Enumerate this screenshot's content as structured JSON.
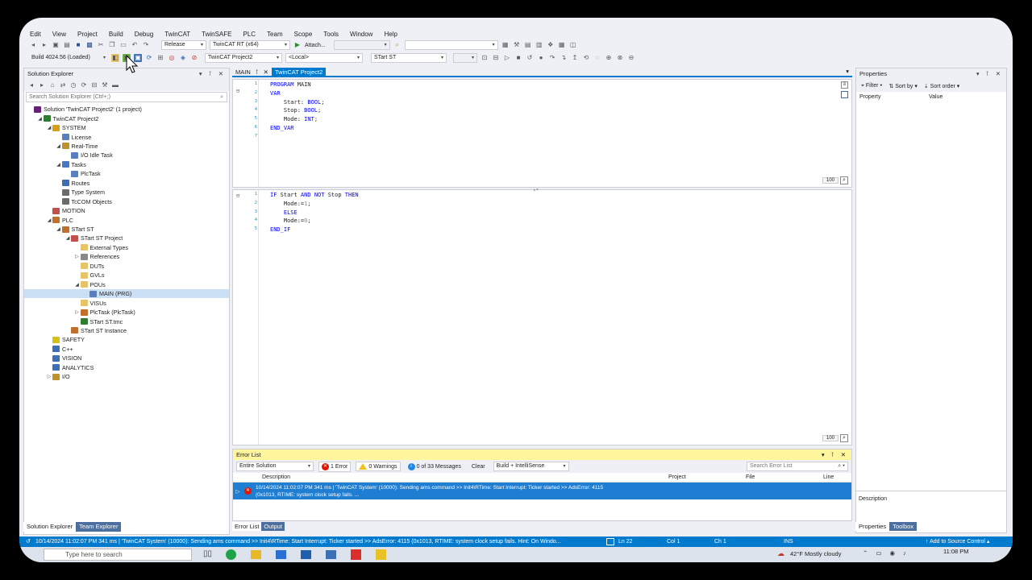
{
  "window": {
    "title": "TwinCAT Project2 - TcXaeShell"
  },
  "menu": [
    "Edit",
    "View",
    "Project",
    "Build",
    "Debug",
    "TwinCAT",
    "TwinSAFE",
    "PLC",
    "Team",
    "Scope",
    "Tools",
    "Window",
    "Help"
  ],
  "toolbar1": {
    "config": "Release",
    "platform": "TwinCAT RT (x64)",
    "attach": "Attach..."
  },
  "toolbar2": {
    "build": "Build 4024.56 (Loaded)",
    "project": "TwinCAT Project2",
    "target": "<Local>",
    "plc": "STart ST"
  },
  "solution_explorer": {
    "title": "Solution Explorer",
    "search_placeholder": "Search Solution Explorer (Ctrl+;)",
    "items": [
      {
        "label": "Solution 'TwinCAT Project2' (1 project)",
        "depth": 0,
        "exp": "",
        "icon": "solution",
        "color": "#68217a"
      },
      {
        "label": "TwinCAT Project2",
        "depth": 1,
        "exp": "◢",
        "icon": "project",
        "color": "#2f7d32"
      },
      {
        "label": "SYSTEM",
        "depth": 2,
        "exp": "◢",
        "icon": "folder",
        "color": "#d4a017"
      },
      {
        "label": "License",
        "depth": 3,
        "exp": "",
        "icon": "license",
        "color": "#5a7fbf"
      },
      {
        "label": "Real-Time",
        "depth": 3,
        "exp": "◢",
        "icon": "gear",
        "color": "#c0902b"
      },
      {
        "label": "I/O Idle Task",
        "depth": 4,
        "exp": "",
        "icon": "task",
        "color": "#5a7fbf"
      },
      {
        "label": "Tasks",
        "depth": 3,
        "exp": "◢",
        "icon": "tasks",
        "color": "#4a78c2"
      },
      {
        "label": "PlcTask",
        "depth": 4,
        "exp": "",
        "icon": "task",
        "color": "#5a7fbf"
      },
      {
        "label": "Routes",
        "depth": 3,
        "exp": "",
        "icon": "routes",
        "color": "#3b6fb6"
      },
      {
        "label": "Type System",
        "depth": 3,
        "exp": "",
        "icon": "types",
        "color": "#6b6b6b"
      },
      {
        "label": "TcCOM Objects",
        "depth": 3,
        "exp": "",
        "icon": "tccom",
        "color": "#6b6b6b"
      },
      {
        "label": "MOTION",
        "depth": 2,
        "exp": "",
        "icon": "motion",
        "color": "#c0504d"
      },
      {
        "label": "PLC",
        "depth": 2,
        "exp": "◢",
        "icon": "plc",
        "color": "#c0702b"
      },
      {
        "label": "STart ST",
        "depth": 3,
        "exp": "◢",
        "icon": "plcproj",
        "color": "#c0702b"
      },
      {
        "label": "STart ST Project",
        "depth": 4,
        "exp": "◢",
        "icon": "project",
        "color": "#c0504d"
      },
      {
        "label": "External Types",
        "depth": 5,
        "exp": "",
        "icon": "folder",
        "color": "#e8c468"
      },
      {
        "label": "References",
        "depth": 5,
        "exp": "▷",
        "icon": "refs",
        "color": "#8a8a8a"
      },
      {
        "label": "DUTs",
        "depth": 5,
        "exp": "",
        "icon": "folder",
        "color": "#e8c468"
      },
      {
        "label": "GVLs",
        "depth": 5,
        "exp": "",
        "icon": "folder",
        "color": "#e8c468"
      },
      {
        "label": "POUs",
        "depth": 5,
        "exp": "◢",
        "icon": "folder",
        "color": "#e8c468"
      },
      {
        "label": "MAIN (PRG)",
        "depth": 6,
        "exp": "",
        "icon": "prg",
        "color": "#5a7fbf",
        "selected": true
      },
      {
        "label": "VISUs",
        "depth": 5,
        "exp": "",
        "icon": "folder",
        "color": "#e8c468"
      },
      {
        "label": "PlcTask (PlcTask)",
        "depth": 5,
        "exp": "▷",
        "icon": "task",
        "color": "#c0702b"
      },
      {
        "label": "STart ST.tmc",
        "depth": 5,
        "exp": "",
        "icon": "tmc",
        "color": "#2f7d32"
      },
      {
        "label": "STart ST Instance",
        "depth": 4,
        "exp": "",
        "icon": "instance",
        "color": "#c0702b"
      },
      {
        "label": "SAFETY",
        "depth": 2,
        "exp": "",
        "icon": "safety",
        "color": "#d4c017"
      },
      {
        "label": "C++",
        "depth": 2,
        "exp": "",
        "icon": "cpp",
        "color": "#3b6fb6"
      },
      {
        "label": "VISION",
        "depth": 2,
        "exp": "",
        "icon": "vision",
        "color": "#3b6fb6"
      },
      {
        "label": "ANALYTICS",
        "depth": 2,
        "exp": "",
        "icon": "analytics",
        "color": "#3b6fb6"
      },
      {
        "label": "I/O",
        "depth": 2,
        "exp": "▷",
        "icon": "io",
        "color": "#c0902b"
      }
    ],
    "tabs": [
      "Solution Explorer",
      "Team Explorer"
    ]
  },
  "editor": {
    "tabs": [
      {
        "label": "MAIN"
      },
      {
        "label": "TwinCAT Project2"
      }
    ],
    "decl": [
      "PROGRAM MAIN",
      "VAR",
      "    Start: BOOL;",
      "    Stop: BOOL;",
      "    Mode: INT;",
      "END_VAR",
      ""
    ],
    "body": [
      "IF Start AND NOT Stop THEN",
      "    Mode:=1;",
      "    ELSE",
      "    Mode:=0;",
      "END_IF"
    ],
    "zoom1": "100",
    "zoom2": "100"
  },
  "properties": {
    "title": "Properties",
    "filter": "Filter",
    "sort_by": "Sort by",
    "sort_order": "Sort order",
    "col_property": "Property",
    "col_value": "Value",
    "description": "Description",
    "tabs": [
      "Properties",
      "Toolbox"
    ]
  },
  "error_list": {
    "title": "Error List",
    "scope": "Entire Solution",
    "errors": "1 Error",
    "warnings": "0 Warnings",
    "messages": "0 of 33 Messages",
    "clear": "Clear",
    "source": "Build + IntelliSense",
    "search_placeholder": "Search Error List",
    "columns": [
      "Description",
      "Project",
      "File",
      "Line"
    ],
    "row_line1": "10/14/2024 11:02:07 PM 341 ms | 'TwinCAT System' (10000): Sending ams command >> Init4\\RTime: Start Interrupt: Ticker started >> AdsError: 4115",
    "row_line2": "(0x1013, RTIME: system clock setup fails. ...",
    "tabs": [
      "Error List",
      "Output"
    ]
  },
  "status": {
    "message": "10/14/2024 11:02:07 PM 341 ms | 'TwinCAT System' (10000): Sending ams command >> Init4\\RTime: Start Interrupt: Ticker started >> AdsError: 4115 (0x1013, RTIME: system clock setup fails.  Hint: On Windo...",
    "ln": "Ln 22",
    "col": "Col 1",
    "ch": "Ch 1",
    "ins": "INS",
    "source_control": "Add to Source Control"
  },
  "taskbar": {
    "search": "Type here to search",
    "weather": "42°F  Mostly cloudy",
    "time": "11:08 PM"
  }
}
